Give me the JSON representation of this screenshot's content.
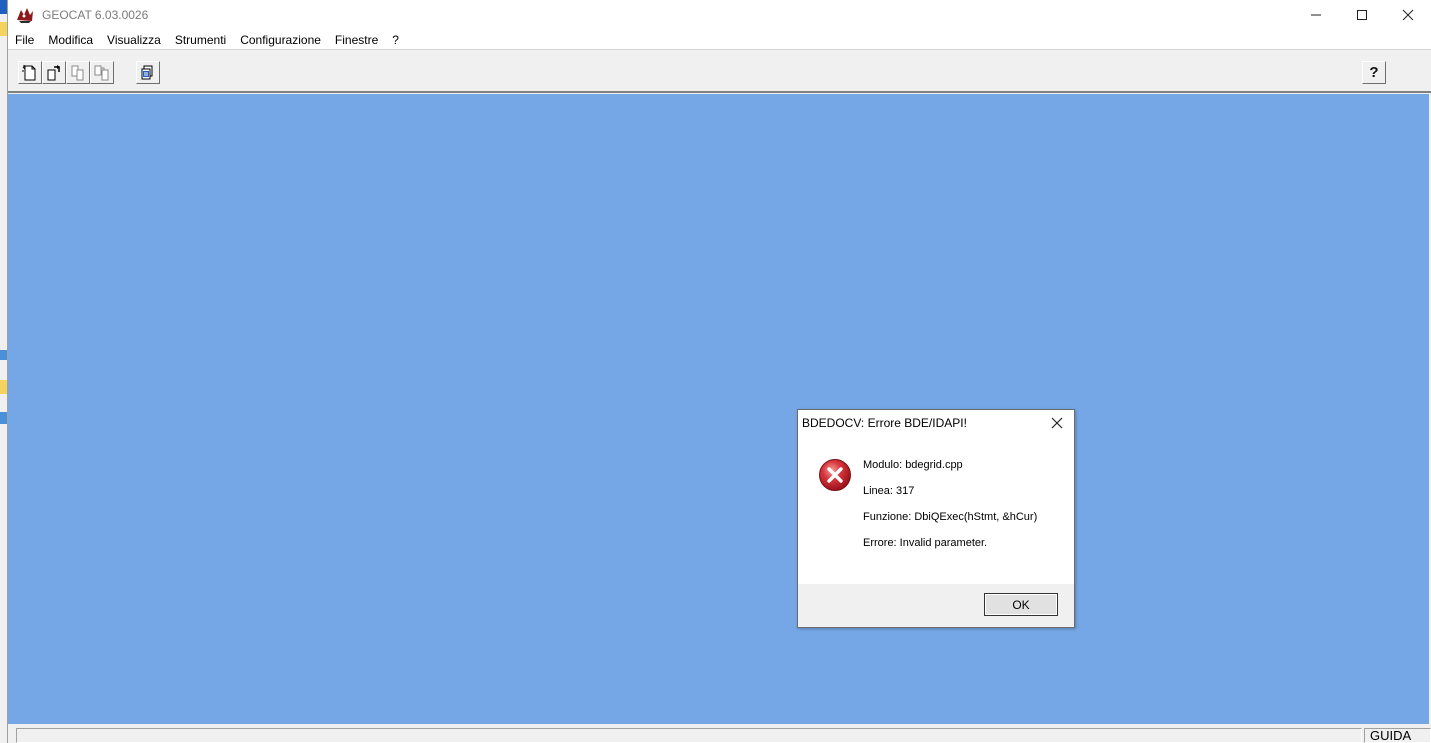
{
  "window": {
    "title": "GEOCAT 6.03.0026",
    "controls": {
      "minimize": "—",
      "maximize": "☐",
      "close": "✕"
    }
  },
  "menu": {
    "items": [
      "File",
      "Modifica",
      "Visualizza",
      "Strumenti",
      "Configurazione",
      "Finestre",
      "?"
    ]
  },
  "toolbar": {
    "buttons": [
      "new-document-icon",
      "open-document-icon",
      "copy-document-icon",
      "paste-document-icon",
      "print-preview-icon"
    ],
    "help_label": "?"
  },
  "client": {
    "background_color": "#75a7e6"
  },
  "statusbar": {
    "help_label": "GUIDA"
  },
  "dialog": {
    "title": "BDEDOCV: Errore BDE/IDAPI!",
    "icon": "error-icon",
    "lines": [
      "Modulo: bdegrid.cpp",
      "Linea: 317",
      "Funzione: DbiQExec(hStmt, &hCur)",
      "Errore: Invalid parameter."
    ],
    "ok_label": "OK",
    "close_label": "✕"
  },
  "colors": {
    "error_red": "#c42b1c",
    "desktop_blue": "#75a7e6",
    "accent_blue": "#1f5fbf"
  }
}
